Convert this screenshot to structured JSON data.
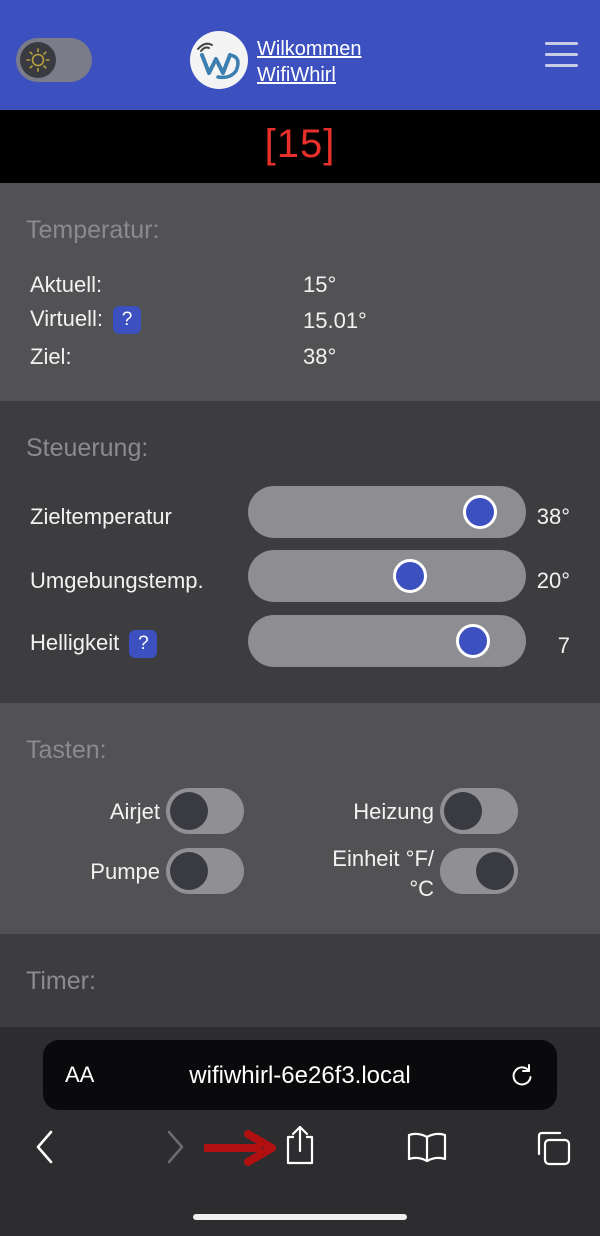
{
  "header": {
    "welcome_line1": "Wilkommen",
    "welcome_line2": "WifiWhirl",
    "theme_icon": "sun-icon",
    "menu_icon": "hamburger-icon",
    "colors": {
      "header_bg": "#3d50c0",
      "accent": "#3d50c0"
    }
  },
  "display": {
    "value": "[15]",
    "color": "#e8302a"
  },
  "temperature": {
    "title": "Temperatur:",
    "rows": [
      {
        "label": "Aktuell:",
        "value": "15°"
      },
      {
        "label": "Virtuell:",
        "value": "15.01°",
        "help": "?"
      },
      {
        "label": "Ziel:",
        "value": "38°"
      }
    ]
  },
  "control": {
    "title": "Steuerung:",
    "sliders": [
      {
        "label": "Zieltemperatur",
        "value": "38°",
        "level": 0.85
      },
      {
        "label": "Umgebungstemp.",
        "value": "20°",
        "level": 0.55
      },
      {
        "label": "Helligkeit",
        "value": "7",
        "level": 0.82,
        "help": "?"
      }
    ]
  },
  "keys": {
    "title": "Tasten:",
    "switches": [
      {
        "label": "Airjet",
        "on": false
      },
      {
        "label": "Heizung",
        "on": false
      },
      {
        "label": "Pumpe",
        "on": false
      },
      {
        "label": "Einheit °F/\n°C",
        "on": true
      }
    ]
  },
  "timer": {
    "title": "Timer:"
  },
  "browser": {
    "text_size": "AA",
    "url": "wifiwhirl-6e26f3.local",
    "icons": [
      "back-icon",
      "forward-icon",
      "share-icon",
      "bookmarks-icon",
      "tabs-icon",
      "reload-icon"
    ],
    "annotation_arrow_color": "#b01010"
  }
}
